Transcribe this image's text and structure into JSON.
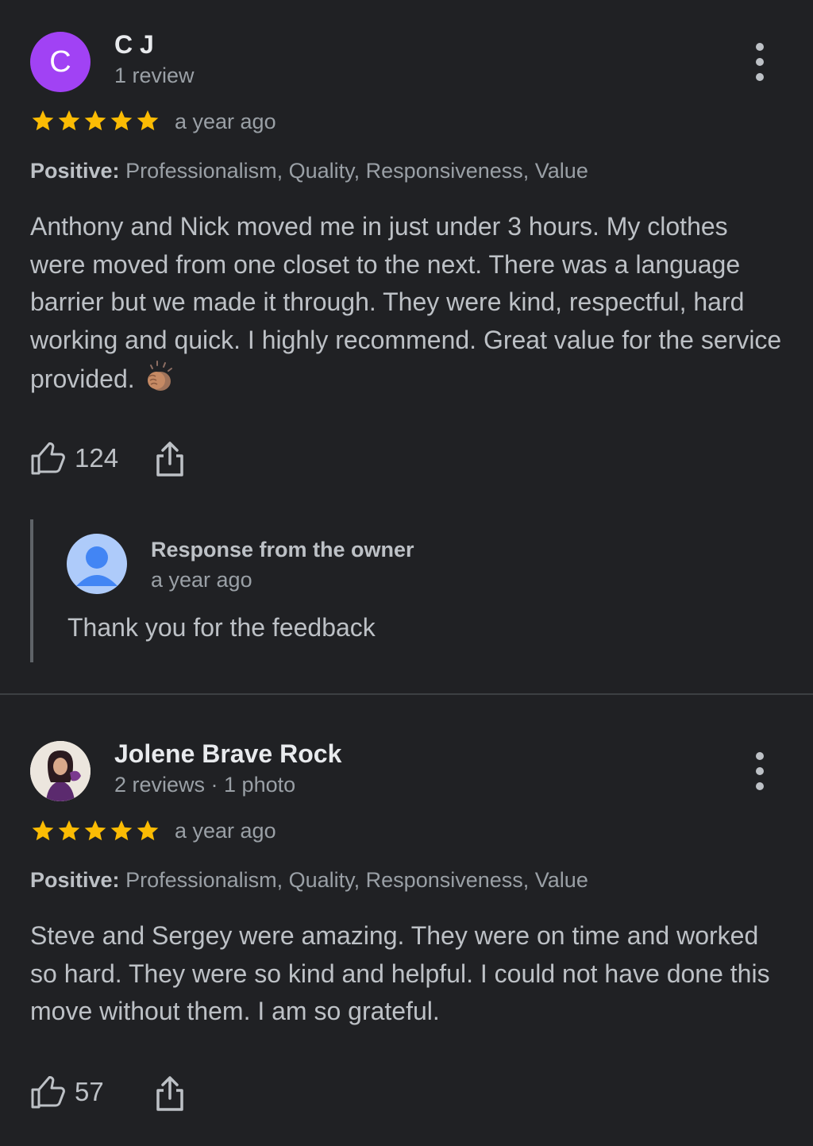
{
  "reviews": [
    {
      "avatar_letter": "C",
      "name": "C J",
      "meta": "1 review",
      "rating": 5,
      "age": "a year ago",
      "positive_label": "Positive:",
      "positive_text": "Professionalism, Quality, Responsiveness, Value",
      "text": "Anthony and Nick moved me in just under 3 hours. My clothes were moved from one closet to the next. There was a language barrier but we made it through. They were kind, respectful, hard working and quick. I highly recommend. Great value for the service provided.",
      "emoji": "clapping-hands-emoji",
      "likes": "124",
      "owner_response": {
        "title": "Response from the owner",
        "age": "a year ago",
        "text": "Thank you for the feedback"
      }
    },
    {
      "name": "Jolene Brave Rock",
      "meta": "2 reviews · 1 photo",
      "rating": 5,
      "age": "a year ago",
      "positive_label": "Positive:",
      "positive_text": "Professionalism, Quality, Responsiveness, Value",
      "text": "Steve and Sergey were amazing. They were on time and worked so hard. They were so kind and helpful. I could not have done this move without them. I am so grateful.",
      "likes": "57"
    }
  ],
  "colors": {
    "background": "#202124",
    "star": "#fbbc04",
    "avatar_cj": "#a142f4",
    "owner_avatar": "#aecbfa"
  },
  "icons": [
    "more-vert-icon",
    "star-icon",
    "thumbs-up-icon",
    "share-icon",
    "person-icon"
  ]
}
